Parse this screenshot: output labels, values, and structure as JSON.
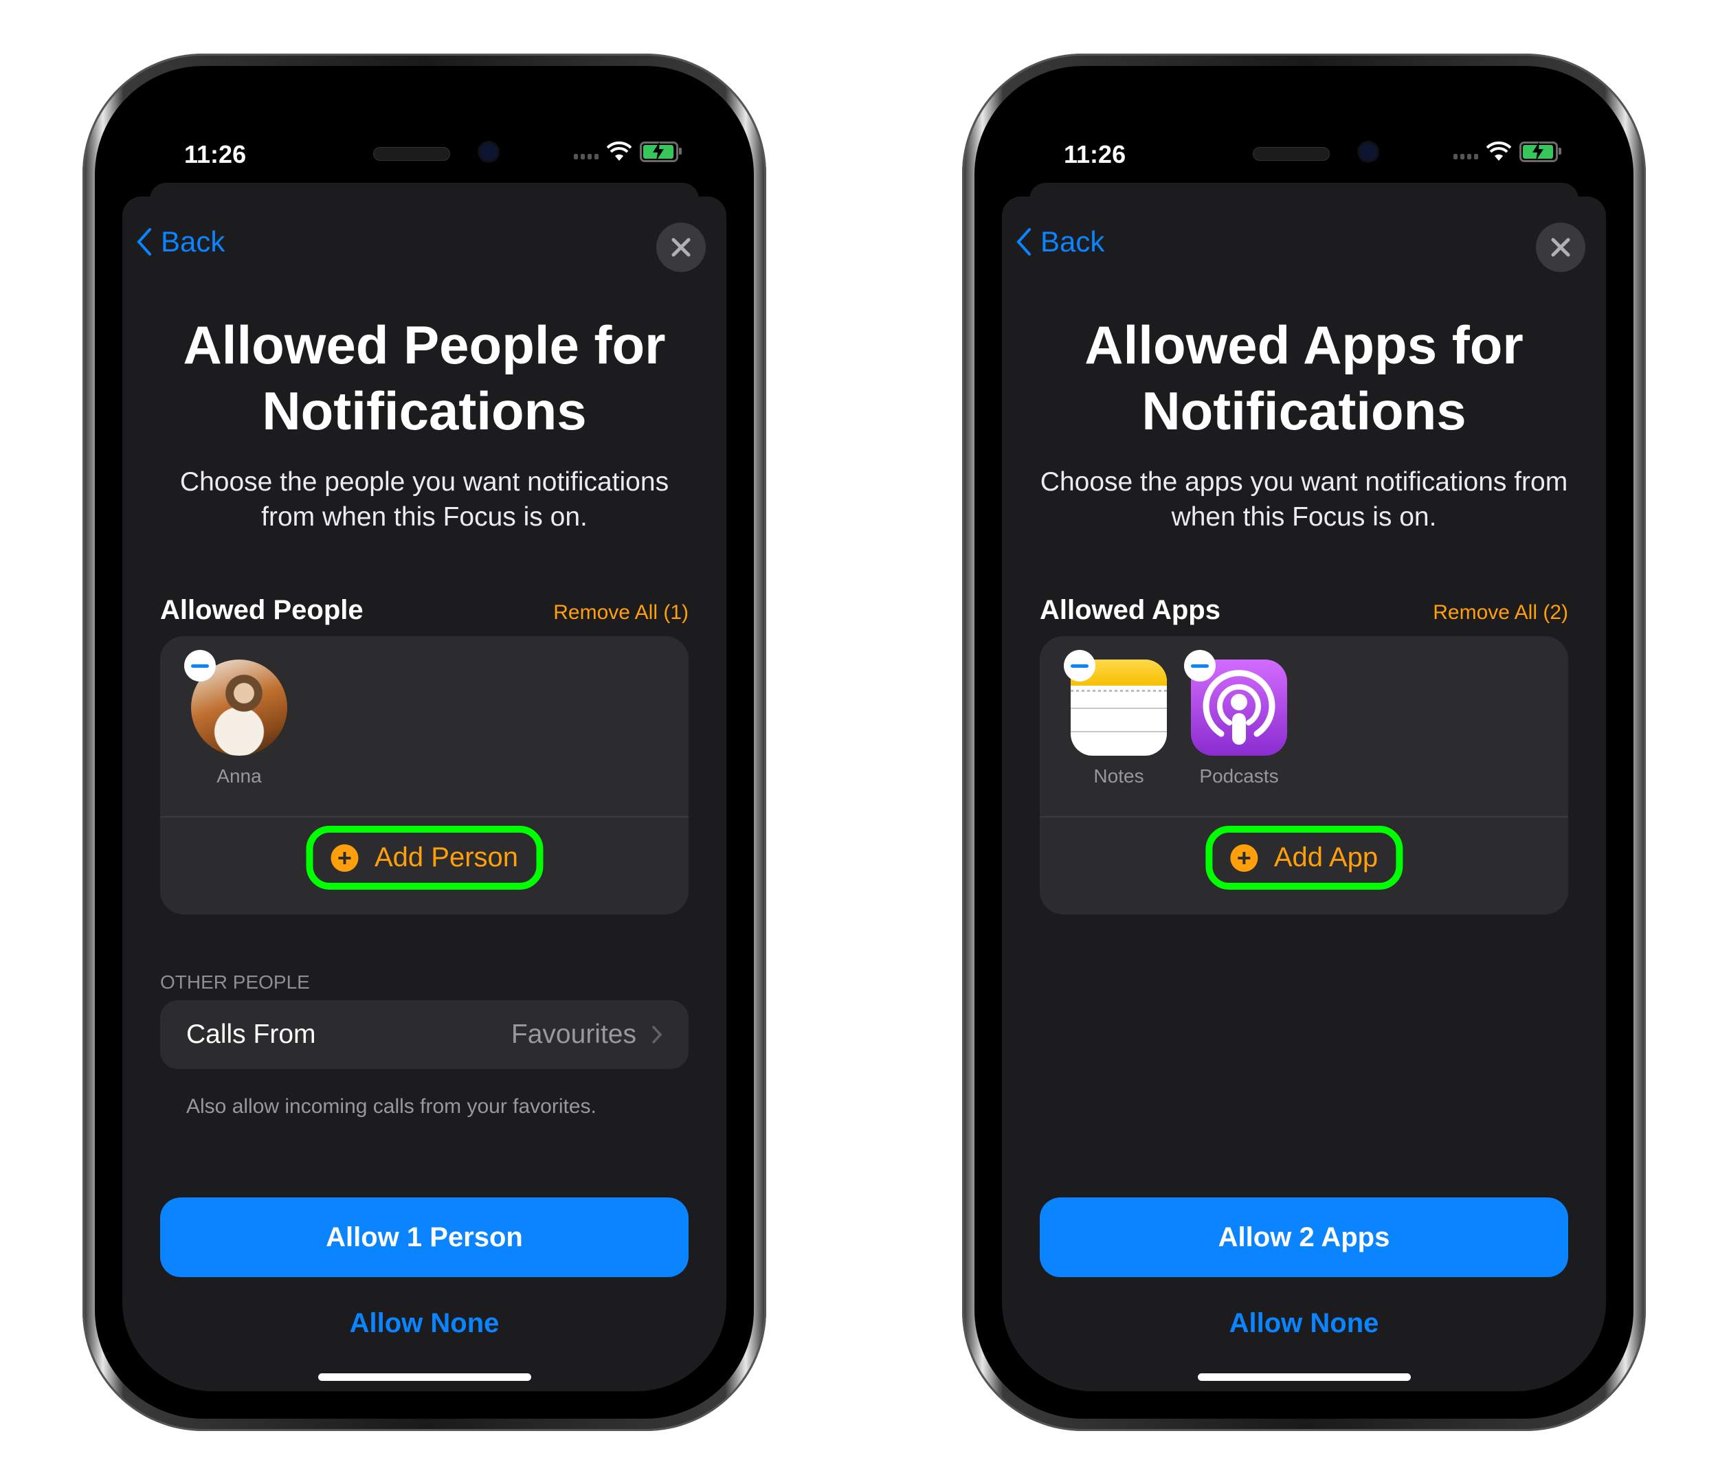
{
  "status_bar": {
    "time": "11:26"
  },
  "colors": {
    "accent_blue": "#0a84ff",
    "accent_orange": "#ff9f0a",
    "highlight_green": "#00ff00",
    "battery_green": "#35c759"
  },
  "left": {
    "back_label": "Back",
    "title": "Allowed People for Notifications",
    "description": "Choose the people you want notifications from when this Focus is on.",
    "section_title": "Allowed People",
    "remove_all": "Remove All (1)",
    "items": [
      {
        "label": "Anna",
        "icon": "contact-avatar"
      }
    ],
    "add_label": "Add Person",
    "other_header": "OTHER PEOPLE",
    "calls_label": "Calls From",
    "calls_value": "Favourites",
    "footnote": "Also allow incoming calls from your favorites.",
    "primary": "Allow 1 Person",
    "secondary": "Allow None"
  },
  "right": {
    "back_label": "Back",
    "title": "Allowed Apps for Notifications",
    "description": "Choose the apps you want notifications from when this Focus is on.",
    "section_title": "Allowed Apps",
    "remove_all": "Remove All (2)",
    "items": [
      {
        "label": "Notes",
        "icon": "notes-app-icon"
      },
      {
        "label": "Podcasts",
        "icon": "podcasts-app-icon"
      }
    ],
    "add_label": "Add App",
    "primary": "Allow 2 Apps",
    "secondary": "Allow None"
  }
}
